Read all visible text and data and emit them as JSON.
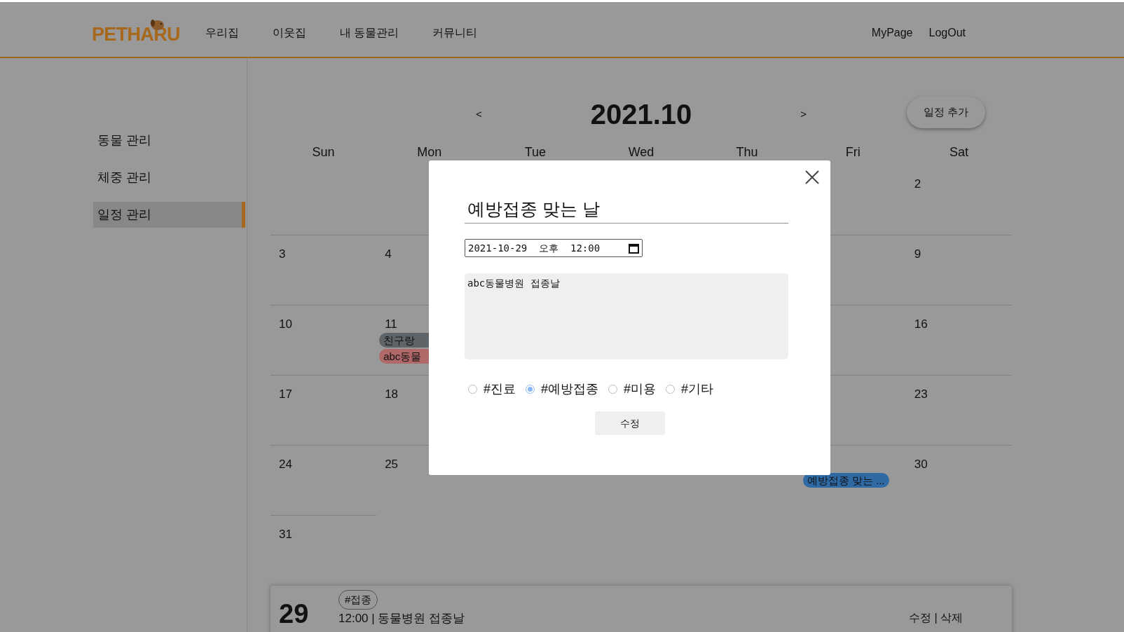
{
  "header": {
    "logo": "PETHARU",
    "nav": [
      {
        "label": "우리집"
      },
      {
        "label": "이웃집"
      },
      {
        "label": "내 동물관리"
      },
      {
        "label": "커뮤니티"
      }
    ],
    "links": [
      {
        "label": "MyPage"
      },
      {
        "label": "LogOut"
      }
    ]
  },
  "sidebar": {
    "items": [
      {
        "label": "동물 관리",
        "selected": false
      },
      {
        "label": "체중 관리",
        "selected": false
      },
      {
        "label": "일정 관리",
        "selected": true
      }
    ]
  },
  "calendar": {
    "prev": "<",
    "title": "2021.10",
    "next": ">",
    "add_button": "일정 추가",
    "weekdays": [
      "Sun",
      "Mon",
      "Tue",
      "Wed",
      "Thu",
      "Fri",
      "Sat"
    ],
    "weeks": [
      {
        "cells": [
          {},
          {},
          {},
          {},
          {},
          {},
          {
            "day": "2"
          }
        ]
      },
      {
        "cells": [
          {
            "day": "3"
          },
          {
            "day": "4"
          },
          {},
          {},
          {},
          {},
          {
            "day": "9"
          }
        ]
      },
      {
        "cells": [
          {
            "day": "10"
          },
          {
            "day": "11",
            "events": [
              {
                "title": "친구랑",
                "color": "#5f6469"
              },
              {
                "title": "abc동물",
                "color": "#b06868"
              }
            ]
          },
          {},
          {},
          {},
          {},
          {
            "day": "16"
          }
        ]
      },
      {
        "cells": [
          {
            "day": "17"
          },
          {
            "day": "18"
          },
          {},
          {},
          {},
          {},
          {
            "day": "23"
          }
        ]
      },
      {
        "cells": [
          {
            "day": "24"
          },
          {
            "day": "25"
          },
          {},
          {},
          {},
          {
            "events": [
              {
                "title": "예방접종 맞는 ...",
                "color": "#2f6aa5"
              }
            ]
          },
          {
            "day": "30"
          }
        ]
      },
      {
        "cells": [
          {
            "day": "31"
          }
        ]
      }
    ]
  },
  "schedule_card": {
    "tag": "#접종",
    "day": "29",
    "line": "12:00 | 동물병원 접종날",
    "actions": "수정 | 삭제"
  },
  "modal": {
    "title_value": "예방접종 맞는 날",
    "datetime": "2021-10-29  오후  12:00",
    "memo": "abc동물병원 접종날",
    "categories": [
      {
        "label": "#진료",
        "selected": false
      },
      {
        "label": "#예방접종",
        "selected": true
      },
      {
        "label": "#미용",
        "selected": false
      },
      {
        "label": "#기타",
        "selected": false
      }
    ],
    "submit": "수정"
  }
}
